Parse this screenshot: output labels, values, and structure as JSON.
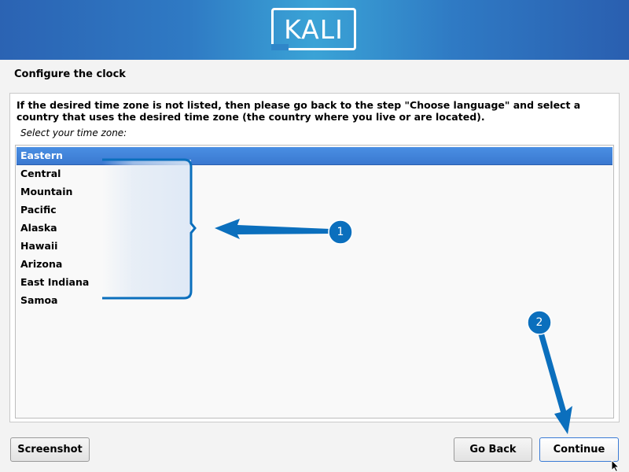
{
  "header": {
    "logo_text": "KALI"
  },
  "page": {
    "title": "Configure the clock",
    "description": "If the desired time zone is not listed, then please go back to the step \"Choose language\" and select a country that uses the desired time zone (the country where you live or are located).",
    "prompt": "Select your time zone:"
  },
  "timezones": {
    "selected": "Eastern",
    "items": [
      "Eastern",
      "Central",
      "Mountain",
      "Pacific",
      "Alaska",
      "Hawaii",
      "Arizona",
      "East Indiana",
      "Samoa"
    ]
  },
  "annotations": {
    "badge_1": "1",
    "badge_2": "2",
    "accent": "#0b6fbd"
  },
  "buttons": {
    "screenshot": "Screenshot",
    "go_back": "Go Back",
    "continue": "Continue"
  }
}
